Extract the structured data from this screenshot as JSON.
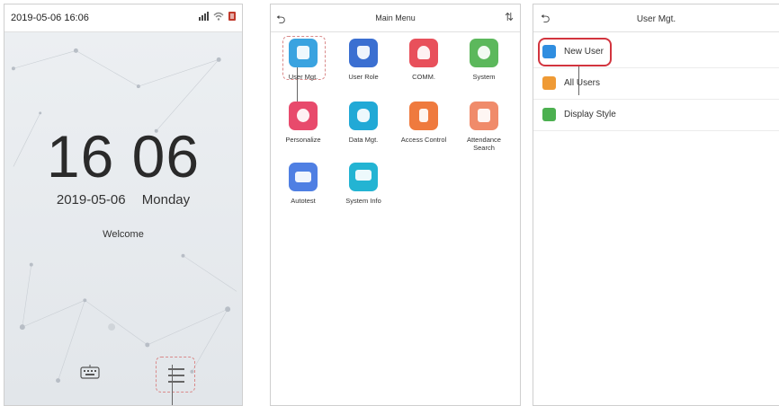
{
  "screen1": {
    "status_datetime": "2019-05-06 16:06",
    "clock": "16 06",
    "date": "2019-05-06",
    "weekday": "Monday",
    "welcome": "Welcome",
    "keyboard_icon": "keyboard-icon",
    "menu_icon": "menu-icon"
  },
  "screen2": {
    "title": "Main Menu",
    "sort_icon": "⇅",
    "items": [
      {
        "label": "User Mgt.",
        "color": "#3aa3e0"
      },
      {
        "label": "User Role",
        "color": "#3b6fd1"
      },
      {
        "label": "COMM.",
        "color": "#e8505b"
      },
      {
        "label": "System",
        "color": "#5cb85c"
      },
      {
        "label": "Personalize",
        "color": "#e84a6c"
      },
      {
        "label": "Data Mgt.",
        "color": "#21a9d6"
      },
      {
        "label": "Access Control",
        "color": "#ef7a3e"
      },
      {
        "label": "Attendance Search",
        "color": "#f08b6a"
      },
      {
        "label": "Autotest",
        "color": "#4f7fe3"
      },
      {
        "label": "System Info",
        "color": "#23b4d3"
      }
    ]
  },
  "screen3": {
    "title": "User Mgt.",
    "items": [
      {
        "label": "New User",
        "color": "#2f8ee0"
      },
      {
        "label": "All Users",
        "color": "#ef9a35"
      },
      {
        "label": "Display Style",
        "color": "#4cb050"
      }
    ]
  },
  "colors": {
    "highlight": "#d2343e",
    "dashed": "#d98a8a"
  }
}
